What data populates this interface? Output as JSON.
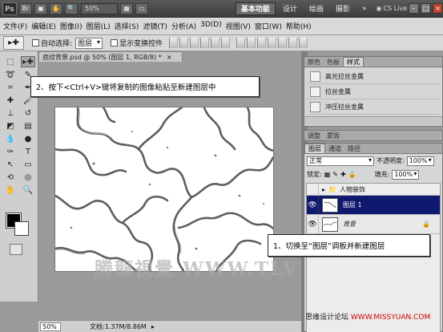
{
  "app": {
    "logo": "Ps",
    "zoom": "50%",
    "cs_live": "CS Live"
  },
  "workspaces": [
    "基本功能",
    "设计",
    "绘画",
    "摄影"
  ],
  "menu": [
    "文件(F)",
    "编辑(E)",
    "图像(I)",
    "图层(L)",
    "选择(S)",
    "滤镜(T)",
    "分析(A)",
    "3D(D)",
    "视图(V)",
    "窗口(W)",
    "帮助(H)"
  ],
  "options": {
    "auto_select_label": "自动选择:",
    "auto_select_value": "图层",
    "show_transform_label": "显示变换控件"
  },
  "document": {
    "tab_title": "底纹背景.psd @ 50% (图层 1, RGB/8) *",
    "tab_close": "×"
  },
  "status": {
    "zoom": "50%",
    "doc_info": "文档:1.37M/8.86M"
  },
  "styles_panel": {
    "tabs": [
      "颜色",
      "色板",
      "样式"
    ],
    "items": [
      "高光拉丝金属",
      "拉丝金属",
      "冲压拉丝金属"
    ]
  },
  "adjust_panel": {
    "tabs": [
      "调整",
      "蒙版"
    ]
  },
  "layers_panel": {
    "tabs": [
      "图层",
      "通道",
      "路径"
    ],
    "blend_mode": "正常",
    "opacity_label": "不透明度:",
    "opacity": "100%",
    "lock_label": "锁定:",
    "fill_label": "填充:",
    "fill": "100%",
    "layers": [
      {
        "name": "人物装饰",
        "type": "group"
      },
      {
        "name": "图层 1",
        "type": "selected"
      },
      {
        "name": "背景",
        "type": "background"
      }
    ]
  },
  "callouts": {
    "step2": "2、按下<Ctrl+V>键将复制的图像粘贴至新建图层中",
    "step1": "1、切换至“图层”调板并新建图层"
  },
  "watermark": "腾龍視覺 WWW.TLVI.NET",
  "footer": {
    "left": "思缘设计论坛",
    "right": "WWW.MISSYUAN.COM"
  },
  "colors": {
    "selected_layer": "#0f1a6e",
    "foreground": "#000000",
    "background": "#ffffff"
  }
}
